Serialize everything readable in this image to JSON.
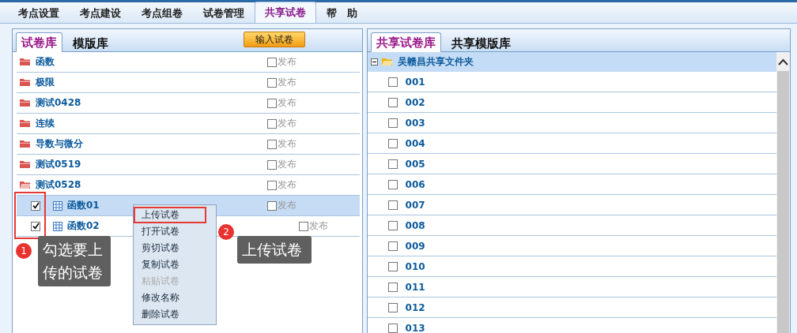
{
  "nav_tabs": [
    {
      "label": "考点设置",
      "selected": false
    },
    {
      "label": "考点建设",
      "selected": false
    },
    {
      "label": "考点组卷",
      "selected": false
    },
    {
      "label": "试卷管理",
      "selected": false
    },
    {
      "label": "共享试卷",
      "selected": true
    },
    {
      "label": "帮　助",
      "selected": false
    }
  ],
  "left_panel": {
    "tabs": [
      {
        "label": "试卷库",
        "selected": true
      },
      {
        "label": "模版库",
        "selected": false
      }
    ],
    "import_button": "输入试卷",
    "tree": [
      {
        "name": "函数",
        "expanded": false,
        "publish": {
          "label": "发布",
          "checked": false
        }
      },
      {
        "name": "极限",
        "expanded": false,
        "publish": {
          "label": "发布",
          "checked": false
        }
      },
      {
        "name": "测试0428",
        "expanded": false,
        "publish": {
          "label": "发布",
          "checked": false
        }
      },
      {
        "name": "连续",
        "expanded": false,
        "publish": {
          "label": "发布",
          "checked": false
        }
      },
      {
        "name": "导数与微分",
        "expanded": false,
        "publish": {
          "label": "发布",
          "checked": false
        }
      },
      {
        "name": "测试0519",
        "expanded": false,
        "publish": {
          "label": "发布",
          "checked": false
        }
      },
      {
        "name": "测试0528",
        "expanded": true,
        "publish": {
          "label": "发布",
          "checked": false
        },
        "children": [
          {
            "name": "函数01",
            "checked": true,
            "selected": true,
            "publish": {
              "label": "发布",
              "checked": false
            }
          },
          {
            "name": "函数02",
            "checked": true,
            "selected": false,
            "publish": {
              "label": "发布",
              "checked": false
            }
          }
        ]
      }
    ]
  },
  "context_menu": [
    {
      "label": "上传试卷",
      "disabled": false,
      "marked": true
    },
    {
      "label": "打开试卷",
      "disabled": false,
      "marked": false
    },
    {
      "label": "剪切试卷",
      "disabled": false,
      "marked": false
    },
    {
      "label": "复制试卷",
      "disabled": false,
      "marked": false
    },
    {
      "label": "粘贴试卷",
      "disabled": true,
      "marked": false
    },
    {
      "label": "修改名称",
      "disabled": false,
      "marked": false
    },
    {
      "label": "删除试卷",
      "disabled": false,
      "marked": false
    }
  ],
  "annotations": [
    {
      "number": "1",
      "text": "勾选要上传的试卷"
    },
    {
      "number": "2",
      "text": "上传试卷"
    }
  ],
  "right_panel": {
    "tabs": [
      {
        "label": "共享试卷库",
        "selected": true
      },
      {
        "label": "共享模版库",
        "selected": false
      }
    ],
    "folder": {
      "name": "吴赣昌共享文件夹",
      "expanded": true
    },
    "items": [
      {
        "name": "001",
        "checked": false
      },
      {
        "name": "002",
        "checked": false
      },
      {
        "name": "003",
        "checked": false
      },
      {
        "name": "004",
        "checked": false
      },
      {
        "name": "005",
        "checked": false
      },
      {
        "name": "006",
        "checked": false
      },
      {
        "name": "007",
        "checked": false
      },
      {
        "name": "008",
        "checked": false
      },
      {
        "name": "009",
        "checked": false
      },
      {
        "name": "010",
        "checked": false
      },
      {
        "name": "011",
        "checked": false
      },
      {
        "name": "012",
        "checked": false
      },
      {
        "name": "013",
        "checked": false
      }
    ]
  }
}
